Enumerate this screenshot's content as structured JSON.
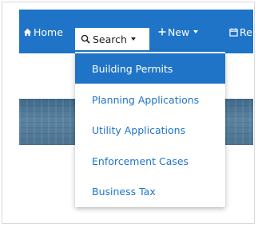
{
  "nav": {
    "home_label": "Home",
    "search_label": "Search",
    "new_label": "New",
    "calendar_label": "Re"
  },
  "search_menu": {
    "items": [
      {
        "label": "Building Permits",
        "active": true
      },
      {
        "label": "Planning Applications",
        "active": false
      },
      {
        "label": "Utility Applications",
        "active": false
      },
      {
        "label": "Enforcement Cases",
        "active": false
      },
      {
        "label": "Business Tax",
        "active": false
      }
    ]
  },
  "colors": {
    "navbar": "#1f74c7",
    "menu_text": "#1f74c7",
    "active_bg": "#1f74c7"
  },
  "icons": {
    "home": "home-icon",
    "search": "search-icon",
    "new": "plus-icon",
    "calendar": "calendar-icon"
  }
}
